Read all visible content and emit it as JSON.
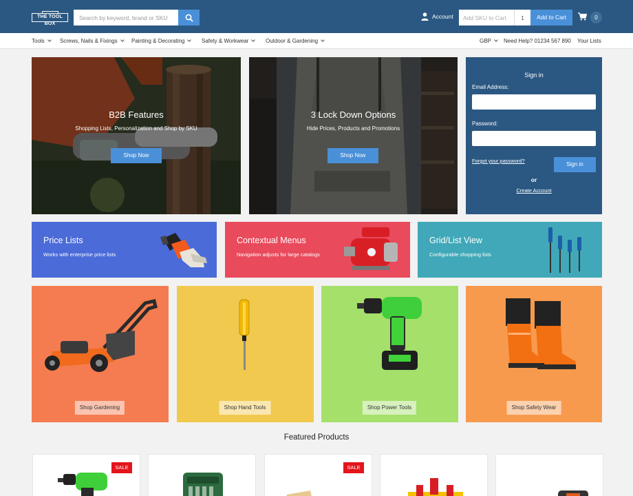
{
  "header": {
    "logo": "THE TOOL BOX",
    "search_placeholder": "Search by keyword, brand or SKU",
    "account_label": "Account",
    "sku_placeholder": "Add SKU to Cart",
    "qty_value": "1",
    "add_to_cart_label": "Add to Cart",
    "cart_count": "0",
    "icons": [
      "search-icon",
      "user-icon",
      "cart-icon"
    ]
  },
  "nav": {
    "items": [
      {
        "label": "Tools"
      },
      {
        "label": "Screws, Nails & Fixings"
      },
      {
        "label": "Painting & Decorating"
      },
      {
        "label": "Safety & Workwear"
      },
      {
        "label": "Outdoor & Gardening"
      }
    ],
    "currency": "GBP",
    "help": "Need Help? 01234 567 890",
    "lists": "Your Lists"
  },
  "heroes": [
    {
      "title": "B2B Features",
      "subtitle": "Shopping Lists, Personalization and Shop by SKU",
      "button": "Shop Now"
    },
    {
      "title": "3 Lock Down Options",
      "subtitle": "Hide Prices, Products and Promotions",
      "button": "Shop Now"
    }
  ],
  "signin": {
    "title": "Sign in",
    "email_label": "Email Address:",
    "password_label": "Password:",
    "forgot": "Forgot your password?",
    "button": "Sign in",
    "or": "or",
    "create": "Create Account"
  },
  "promos": [
    {
      "title": "Price Lists",
      "subtitle": "Works with enterprise price lists",
      "color": "#4b6bd9"
    },
    {
      "title": "Contextual Menus",
      "subtitle": "Navigation adjusts for large catalogs",
      "color": "#e94a5c"
    },
    {
      "title": "Grid/List View",
      "subtitle": "Configurable shopping lists",
      "color": "#40a8b8"
    }
  ],
  "categories": [
    {
      "button": "Shop Gardening",
      "color": "#f47c50"
    },
    {
      "button": "Shop Hand Tools",
      "color": "#f1c94f"
    },
    {
      "button": "Shop Power Tools",
      "color": "#a5e06b"
    },
    {
      "button": "Shop Safety Wear",
      "color": "#f79a4e"
    }
  ],
  "featured_title": "Featured Products",
  "products": [
    {
      "badge": "SALE"
    },
    {
      "badge": ""
    },
    {
      "badge": "SALE"
    },
    {
      "badge": ""
    },
    {
      "badge": ""
    }
  ],
  "colors": {
    "brand": "#2b5882",
    "accent": "#4a90d9",
    "sale": "#e4141b"
  }
}
